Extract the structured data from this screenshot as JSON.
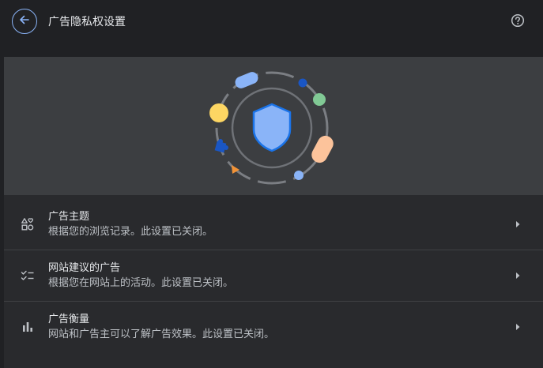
{
  "header": {
    "title": "广告隐私权设置",
    "back_icon": "arrow-back-icon",
    "help_icon": "help-circle-icon"
  },
  "hero": {
    "illustration": "shield-with-orbit-illustration",
    "colors": {
      "background": "#3c3e41",
      "shield_fill": "#8ab4f8",
      "shield_stroke": "#1a73e8",
      "yellow": "#fdd663",
      "green": "#81c995",
      "peach": "#fcc39b",
      "blue_dark": "#1a56c4",
      "orange": "#f29337"
    }
  },
  "settings": [
    {
      "title": "广告主题",
      "subtitle": "根据您的浏览记录。此设置已关闭。",
      "icon": "shapes-icon"
    },
    {
      "title": "网站建议的广告",
      "subtitle": "根据您在网站上的活动。此设置已关闭。",
      "icon": "checklist-icon"
    },
    {
      "title": "广告衡量",
      "subtitle": "网站和广告主可以了解广告效果。此设置已关闭。",
      "icon": "bar-chart-icon"
    }
  ],
  "colors": {
    "page_bg": "#202124",
    "panel_bg": "#292a2d",
    "accent": "#8ab4f8",
    "text_primary": "#e8eaed",
    "text_secondary": "#bdc1c6"
  }
}
